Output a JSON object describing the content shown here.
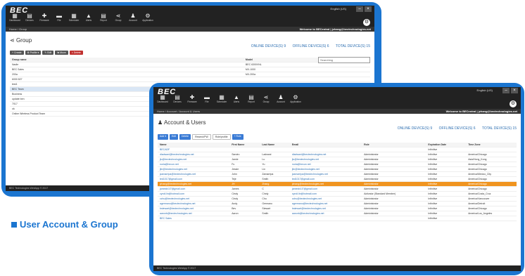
{
  "app": {
    "logo": "BEC",
    "language": "English (US)",
    "welcome": "Welcome to BECentral | jzhang@bectechnologies.net",
    "copyright": "BEC Technologies WebApp © 2017"
  },
  "nav": [
    {
      "label": "Dashboard",
      "icon": "▦"
    },
    {
      "label": "Devices",
      "icon": "▤"
    },
    {
      "label": "Firmware",
      "icon": "✚"
    },
    {
      "label": "File",
      "icon": "▬"
    },
    {
      "label": "Scheduler",
      "icon": "▦"
    },
    {
      "label": "Alerts",
      "icon": "▲"
    },
    {
      "label": "Report",
      "icon": "▤"
    },
    {
      "label": "Group",
      "icon": "⋖"
    },
    {
      "label": "Account",
      "icon": "♟"
    },
    {
      "label": "Application",
      "icon": "⚙"
    }
  ],
  "group": {
    "breadcrumb": "Home / Group",
    "title": "Group",
    "online": "ONLINE DEVICE(S) 9",
    "offline": "OFFLINE DEVICE(S) 6",
    "total": "TOTAL DEVICE(S) 15",
    "buttons": {
      "create": "+ Create",
      "profile": "⚙ Profile ▾",
      "edit": "✎ Edit",
      "move": "⇆ Move",
      "delete": "× Delete"
    },
    "search_placeholder": "Searching",
    "columns": [
      "Group name",
      "Model"
    ],
    "rows": [
      [
        "Nadie",
        "BEC 6300VNL"
      ],
      [
        "BEC Sales",
        "MX-1000"
      ],
      [
        "200a",
        "MX-200a"
      ],
      [
        "6000 827",
        ""
      ],
      [
        "test1",
        ""
      ],
      [
        "BEC Team",
        ""
      ],
      [
        "Business",
        ""
      ],
      [
        "update ben",
        ""
      ],
      [
        "7017",
        ""
      ],
      [
        "ok",
        ""
      ],
      [
        "Online Wireless Product Team",
        ""
      ]
    ]
  },
  "account": {
    "breadcrumb": "Home / Account / Account & Users",
    "title": "Account & Users",
    "online": "ONLINE DEVICE(S) 9",
    "offline": "OFFLINE DEVICE(S) 6",
    "total": "TOTAL DEVICE(S) 15",
    "buttons": {
      "add": "Add ▾",
      "edit": "Edit",
      "delete": "Delete",
      "resetpw": "Resend/PW",
      "roles": "Role/profile",
      "new": "+ Role"
    },
    "columns": [
      "Name",
      "First Name",
      "Last Name",
      "Email",
      "Role",
      "Expiration Date",
      "Time Zone"
    ],
    "rows": [
      [
        "BECADF",
        "",
        "",
        "",
        "",
        "Infinitive",
        ""
      ],
      [
        "dladwani@bectechnologies.net",
        "Sandro",
        "Ladwani",
        "dladwani@bectechnologies.net",
        "Administrator",
        "Infinitive",
        "America/Chicago"
      ],
      [
        "jlu@bectechnologies.net",
        "Jamie",
        "Lu",
        "jlu@bectechnologies.net",
        "Administrator",
        "Infinitive",
        "Asia/Hong_Kong"
      ],
      [
        "nuria@hecun.net",
        "Fu",
        "Yu",
        "nuria@hecun.net",
        "Administrator",
        "Infinitive",
        "America/Chicago"
      ],
      [
        "jlin@bectechnologies.net",
        "Jessie",
        "Lin",
        "jlin@bectechnologies.net",
        "Administrator",
        "Infinitive",
        "America/Chicago"
      ],
      [
        "jzamarripa@bectechnologies.net",
        "John",
        "Zamarripa",
        "jzamarripa@bectechnologies.net",
        "Administrator",
        "Infinitive",
        "America/Mexico_City"
      ],
      [
        "ted1017@gmail.com",
        "Teje",
        "Smith",
        "ted1017@gmail.com",
        "Administrator",
        "Infinitive",
        "America/Chicago"
      ],
      [
        "jzhang@bectechnologies.net",
        "JH",
        "Zhang",
        "jzhang@bectechnologies.net",
        "Administrator",
        "Infinitive",
        "America/Chicago"
      ],
      [
        "jamesfc1l7@gmail.com",
        "James",
        "C",
        "jamesfc1l7@gmail.com",
        "Administrator",
        "Infinitive",
        "America/Chicago"
      ],
      [
        "cyndi.lin@hotmail.com",
        "Cindy",
        "Cindy",
        "cyndi.lin@hotmail.com",
        "Activator (Standard Member)",
        "Infinitive",
        "America/Costa_Cruz"
      ],
      [
        "cchu@bectechnologies.net",
        "Cindy",
        "Chu",
        "cchu@bectechnologies.net",
        "Administrator",
        "Infinitive",
        "America/Vancouver"
      ],
      [
        "agermano@bectechnologies.net",
        "Andy",
        "Germano",
        "agermano@bectechnologies.net",
        "Administrator",
        "Infinitive",
        "America/Detroit"
      ],
      [
        "bstewart@bectechnologies.net",
        "Bev",
        "Stewart",
        "bstewart@bectechnologies.net",
        "Administrator",
        "Infinitive",
        "America/Chicago"
      ],
      [
        "aaronb@bectechnologies.net",
        "Aaron",
        "Smith",
        "aaronb@bectechnologies.net",
        "Administrator",
        "Infinitive",
        "America/Los_Angeles"
      ],
      [
        "BEC Sales",
        "",
        "",
        "",
        "",
        "Infinitive",
        ""
      ]
    ]
  },
  "caption": "User Account & Group"
}
